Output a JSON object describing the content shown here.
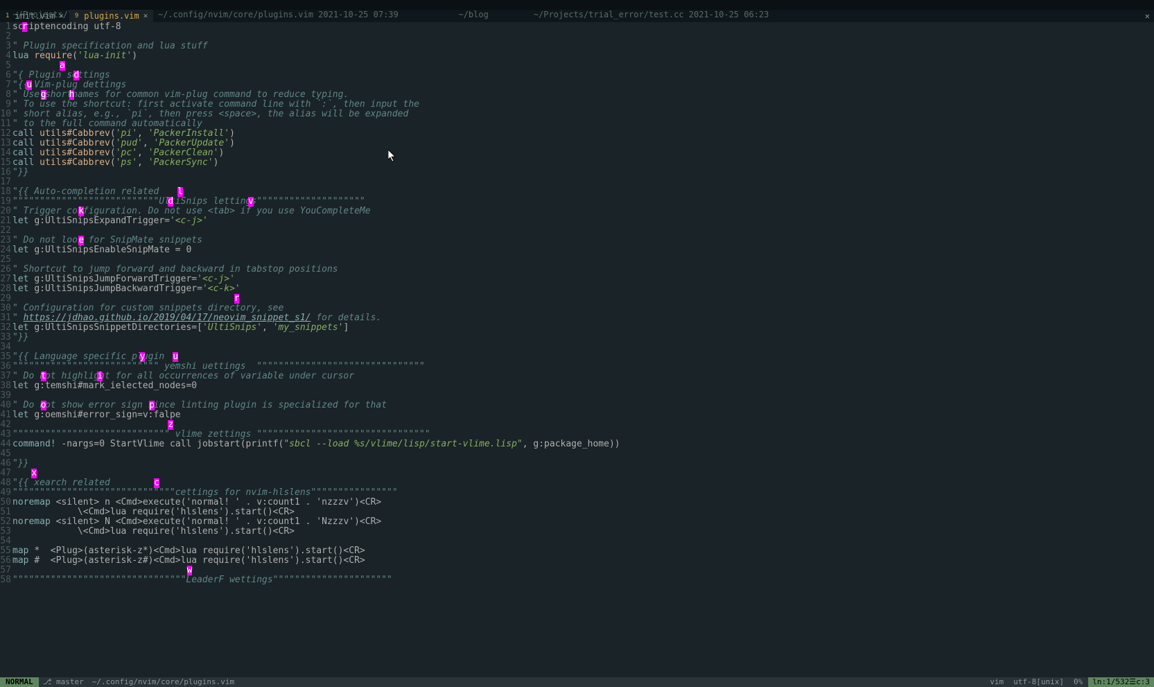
{
  "topbar": {
    "paths": "~/Projects/leet_code         ~/.config/nvim/core/plugins.vim 2021-10-25 07:39            ~/blog         ~/Projects/trial_error/test.cc 2021-10-25 06:23"
  },
  "tabs": [
    {
      "index": "1",
      "label": "init.vim",
      "active": false
    },
    {
      "index": "9",
      "label": "plugins.vim",
      "active": true
    }
  ],
  "status": {
    "mode": "NORMAL",
    "branch": "⎇  master",
    "path": "~/.config/nvim/core/plugins.vim",
    "filetype": "vim",
    "encoding": "utf-8[unix]",
    "percent": "0%",
    "position": "ln:1/532☰c:3"
  },
  "hops": {
    "1": [
      {
        "col": 2,
        "ch": "r"
      }
    ],
    "5": [
      {
        "col": 10,
        "ch": "a"
      }
    ],
    "6": [
      {
        "col": 13,
        "ch": "d"
      }
    ],
    "7": [
      {
        "col": 3,
        "ch": "u"
      }
    ],
    "8": [
      {
        "col": 6,
        "ch": "g"
      },
      {
        "col": 12,
        "ch": "h"
      }
    ],
    "18": [
      {
        "col": 35,
        "ch": "l"
      }
    ],
    "19": [
      {
        "col": 33,
        "ch": "d"
      },
      {
        "col": 50,
        "ch": "v"
      }
    ],
    "20": [
      {
        "col": 14,
        "ch": "k"
      }
    ],
    "23": [
      {
        "col": 14,
        "ch": "e"
      }
    ],
    "29": [
      {
        "col": 47,
        "ch": "r"
      }
    ],
    "35": [
      {
        "col": 27,
        "ch": "y"
      },
      {
        "col": 34,
        "ch": "u"
      }
    ],
    "37": [
      {
        "col": 6,
        "ch": "t"
      },
      {
        "col": 18,
        "ch": "i"
      }
    ],
    "40": [
      {
        "col": 6,
        "ch": "o"
      },
      {
        "col": 29,
        "ch": "p"
      }
    ],
    "42": [
      {
        "col": 33,
        "ch": "z"
      }
    ],
    "47": [
      {
        "col": 4,
        "ch": "x"
      }
    ],
    "48": [
      {
        "col": 30,
        "ch": "c"
      }
    ],
    "57": [
      {
        "col": 37,
        "ch": "w"
      }
    ]
  },
  "lines": [
    {
      "n": 1,
      "seg": [
        {
          "c": "ident",
          "t": "scriptencoding utf-8"
        }
      ]
    },
    {
      "n": 2,
      "seg": []
    },
    {
      "n": 3,
      "seg": [
        {
          "c": "comment",
          "t": "\" Plugin specification and lua stuff"
        }
      ]
    },
    {
      "n": 4,
      "seg": [
        {
          "c": "keyword",
          "t": "lua "
        },
        {
          "c": "func",
          "t": "require"
        },
        {
          "c": "ident",
          "t": "("
        },
        {
          "c": "string",
          "t": "'lua-init'"
        },
        {
          "c": "ident",
          "t": ")"
        }
      ]
    },
    {
      "n": 5,
      "seg": []
    },
    {
      "n": 6,
      "seg": [
        {
          "c": "comment",
          "t": "\"{ Plugin settings"
        }
      ]
    },
    {
      "n": 7,
      "seg": [
        {
          "c": "comment",
          "t": "\"{{ Vim-plug dettings"
        }
      ]
    },
    {
      "n": 8,
      "seg": [
        {
          "c": "comment",
          "t": "\" Use shortnames for common vim-plug command to reduce typing."
        }
      ]
    },
    {
      "n": 9,
      "seg": [
        {
          "c": "comment",
          "t": "\" To use the shortcut: first activate command line with `:`, then input the"
        }
      ]
    },
    {
      "n": 10,
      "seg": [
        {
          "c": "comment",
          "t": "\" short alias, e.g., `pi`, then press <space>, the alias will be expanded"
        }
      ]
    },
    {
      "n": 11,
      "seg": [
        {
          "c": "comment",
          "t": "\" to the full command automatically"
        }
      ]
    },
    {
      "n": 12,
      "seg": [
        {
          "c": "keyword",
          "t": "call "
        },
        {
          "c": "func",
          "t": "utils#Cabbrev"
        },
        {
          "c": "ident",
          "t": "("
        },
        {
          "c": "string",
          "t": "'pi'"
        },
        {
          "c": "ident",
          "t": ", "
        },
        {
          "c": "string",
          "t": "'PackerInstall'"
        },
        {
          "c": "ident",
          "t": ")"
        }
      ]
    },
    {
      "n": 13,
      "seg": [
        {
          "c": "keyword",
          "t": "call "
        },
        {
          "c": "func",
          "t": "utils#Cabbrev"
        },
        {
          "c": "ident",
          "t": "("
        },
        {
          "c": "string",
          "t": "'pud'"
        },
        {
          "c": "ident",
          "t": ", "
        },
        {
          "c": "string",
          "t": "'PackerUpdate'"
        },
        {
          "c": "ident",
          "t": ")"
        }
      ]
    },
    {
      "n": 14,
      "seg": [
        {
          "c": "keyword",
          "t": "call "
        },
        {
          "c": "func",
          "t": "utils#Cabbrev"
        },
        {
          "c": "ident",
          "t": "("
        },
        {
          "c": "string",
          "t": "'pc'"
        },
        {
          "c": "ident",
          "t": ", "
        },
        {
          "c": "string",
          "t": "'PackerClean'"
        },
        {
          "c": "ident",
          "t": ")"
        }
      ]
    },
    {
      "n": 15,
      "seg": [
        {
          "c": "keyword",
          "t": "call "
        },
        {
          "c": "func",
          "t": "utils#Cabbrev"
        },
        {
          "c": "ident",
          "t": "("
        },
        {
          "c": "string",
          "t": "'ps'"
        },
        {
          "c": "ident",
          "t": ", "
        },
        {
          "c": "string",
          "t": "'PackerSync'"
        },
        {
          "c": "ident",
          "t": ")"
        }
      ]
    },
    {
      "n": 16,
      "seg": [
        {
          "c": "comment",
          "t": "\"}}"
        }
      ]
    },
    {
      "n": 17,
      "seg": []
    },
    {
      "n": 18,
      "seg": [
        {
          "c": "comment",
          "t": "\"{{ Auto-completion related"
        }
      ]
    },
    {
      "n": 19,
      "seg": [
        {
          "c": "comment",
          "t": "\"\"\"\"\"\"\"\"\"\"\"\"\"\"\"\"\"\"\"\"\"\"\"\"\"\"\"UltiSnips lettings\"\"\"\"\"\"\"\"\"\"\"\"\"\"\"\"\"\"\"\""
        }
      ]
    },
    {
      "n": 20,
      "seg": [
        {
          "c": "comment",
          "t": "\" Trigger configuration. Do not use <tab> if you use YouCompleteMe"
        }
      ]
    },
    {
      "n": 21,
      "seg": [
        {
          "c": "keyword",
          "t": "let "
        },
        {
          "c": "ident",
          "t": "g:UltiSnipsExpandTrigger="
        },
        {
          "c": "string",
          "t": "'<c-j>'"
        }
      ]
    },
    {
      "n": 22,
      "seg": []
    },
    {
      "n": 23,
      "seg": [
        {
          "c": "comment",
          "t": "\" Do not look for SnipMate snippets"
        }
      ]
    },
    {
      "n": 24,
      "seg": [
        {
          "c": "keyword",
          "t": "let "
        },
        {
          "c": "ident",
          "t": "g:UltiSnipsEnableSnipMate = 0"
        }
      ]
    },
    {
      "n": 25,
      "seg": []
    },
    {
      "n": 26,
      "seg": [
        {
          "c": "comment",
          "t": "\" Shortcut to jump forward and backward in tabstop positions"
        }
      ]
    },
    {
      "n": 27,
      "seg": [
        {
          "c": "keyword",
          "t": "let "
        },
        {
          "c": "ident",
          "t": "g:UltiSnipsJumpForwardTrigger="
        },
        {
          "c": "string",
          "t": "'<c-j>'"
        }
      ]
    },
    {
      "n": 28,
      "seg": [
        {
          "c": "keyword",
          "t": "let "
        },
        {
          "c": "ident",
          "t": "g:UltiSnipsJumpBackwardTrigger="
        },
        {
          "c": "string",
          "t": "'<c-k>'"
        }
      ]
    },
    {
      "n": 29,
      "seg": []
    },
    {
      "n": 30,
      "seg": [
        {
          "c": "comment",
          "t": "\" Configuration for custom snippets directory, see"
        }
      ]
    },
    {
      "n": 31,
      "seg": [
        {
          "c": "comment",
          "t": "\" "
        },
        {
          "c": "url",
          "t": "https://jdhao.github.io/2019/04/17/neovim_snippet_s1/"
        },
        {
          "c": "comment",
          "t": " for details."
        }
      ]
    },
    {
      "n": 32,
      "seg": [
        {
          "c": "keyword",
          "t": "let "
        },
        {
          "c": "ident",
          "t": "g:UltiSnipsSnippetDirectories=["
        },
        {
          "c": "string",
          "t": "'UltiSnips'"
        },
        {
          "c": "ident",
          "t": ", "
        },
        {
          "c": "string",
          "t": "'my_snippets'"
        },
        {
          "c": "ident",
          "t": "]"
        }
      ]
    },
    {
      "n": 33,
      "seg": [
        {
          "c": "comment",
          "t": "\"}}"
        }
      ]
    },
    {
      "n": 34,
      "seg": []
    },
    {
      "n": 35,
      "seg": [
        {
          "c": "comment",
          "t": "\"{{ Language specific plugin"
        }
      ]
    },
    {
      "n": 36,
      "seg": [
        {
          "c": "comment",
          "t": "\"\"\"\"\"\"\"\"\"\"\"\"\"\"\"\"\"\"\"\"\"\"\"\"\"\"\" yemshi uettings  \"\"\"\"\"\"\"\"\"\"\"\"\"\"\"\"\"\"\"\"\"\"\"\"\"\"\"\"\"\"\""
        }
      ]
    },
    {
      "n": 37,
      "seg": [
        {
          "c": "comment",
          "t": "\" Do not highlight for all occurrences of variable under cursor"
        }
      ]
    },
    {
      "n": 38,
      "seg": [
        {
          "c": "keyword",
          "t": "let "
        },
        {
          "c": "ident",
          "t": "g:temshi#mark_ielected_nodes=0"
        }
      ]
    },
    {
      "n": 39,
      "seg": []
    },
    {
      "n": 40,
      "seg": [
        {
          "c": "comment",
          "t": "\" Do not show error sign since linting plugin is specialized for that"
        }
      ]
    },
    {
      "n": 41,
      "seg": [
        {
          "c": "keyword",
          "t": "let "
        },
        {
          "c": "ident",
          "t": "g:oemshi#error_sign=v:falpe"
        }
      ]
    },
    {
      "n": 42,
      "seg": []
    },
    {
      "n": 43,
      "seg": [
        {
          "c": "comment",
          "t": "\"\"\"\"\"\"\"\"\"\"\"\"\"\"\"\"\"\"\"\"\"\"\"\"\"\"\"\"\" vlime zettings \"\"\"\"\"\"\"\"\"\"\"\"\"\"\"\"\"\"\"\"\"\"\"\"\"\"\"\"\"\"\"\""
        }
      ]
    },
    {
      "n": 44,
      "seg": [
        {
          "c": "keyword",
          "t": "command! "
        },
        {
          "c": "ident",
          "t": "-nargs=0 StartVlime call jobstart(printf("
        },
        {
          "c": "string",
          "t": "\"sbcl --load %s/vlime/lisp/start-vlime.lisp\""
        },
        {
          "c": "ident",
          "t": ", g:package_home))"
        }
      ]
    },
    {
      "n": 45,
      "seg": []
    },
    {
      "n": 46,
      "seg": [
        {
          "c": "comment",
          "t": "\"}}"
        }
      ]
    },
    {
      "n": 47,
      "seg": []
    },
    {
      "n": 48,
      "seg": [
        {
          "c": "comment",
          "t": "\"{{ xearch related"
        }
      ]
    },
    {
      "n": 49,
      "seg": [
        {
          "c": "comment",
          "t": "\"\"\"\"\"\"\"\"\"\"\"\"\"\"\"\"\"\"\"\"\"\"\"\"\"\"\"\"\"\"cettings for nvim-hlslens\"\"\"\"\"\"\"\"\"\"\"\"\"\"\"\""
        }
      ]
    },
    {
      "n": 50,
      "seg": [
        {
          "c": "keyword",
          "t": "noremap "
        },
        {
          "c": "ident",
          "t": "<silent> n <Cmd>execute('normal! ' . v:count1 . 'nzzzv')<CR>"
        }
      ]
    },
    {
      "n": 51,
      "seg": [
        {
          "c": "ident",
          "t": "            \\<Cmd>lua require('hlslens').start()<CR>"
        }
      ]
    },
    {
      "n": 52,
      "seg": [
        {
          "c": "keyword",
          "t": "noremap "
        },
        {
          "c": "ident",
          "t": "<silent> N <Cmd>execute('normal! ' . v:count1 . 'Nzzzv')<CR>"
        }
      ]
    },
    {
      "n": 53,
      "seg": [
        {
          "c": "ident",
          "t": "            \\<Cmd>lua require('hlslens').start()<CR>"
        }
      ]
    },
    {
      "n": 54,
      "seg": []
    },
    {
      "n": 55,
      "seg": [
        {
          "c": "keyword",
          "t": "map "
        },
        {
          "c": "ident",
          "t": "*  <Plug>(asterisk-z*)<Cmd>lua require('hlslens').start()<CR>"
        }
      ]
    },
    {
      "n": 56,
      "seg": [
        {
          "c": "keyword",
          "t": "map "
        },
        {
          "c": "ident",
          "t": "#  <Plug>(asterisk-z#)<Cmd>lua require('hlslens').start()<CR>"
        }
      ]
    },
    {
      "n": 57,
      "seg": []
    },
    {
      "n": 58,
      "seg": [
        {
          "c": "comment",
          "t": "\"\"\"\"\"\"\"\"\"\"\"\"\"\"\"\"\"\"\"\"\"\"\"\"\"\"\"\"\"\"\"\"LeaderF wettings\"\"\"\"\"\"\"\"\"\"\"\"\"\"\"\"\"\"\"\"\"\""
        }
      ]
    }
  ],
  "cursor": {
    "line": 1,
    "col": 2
  }
}
